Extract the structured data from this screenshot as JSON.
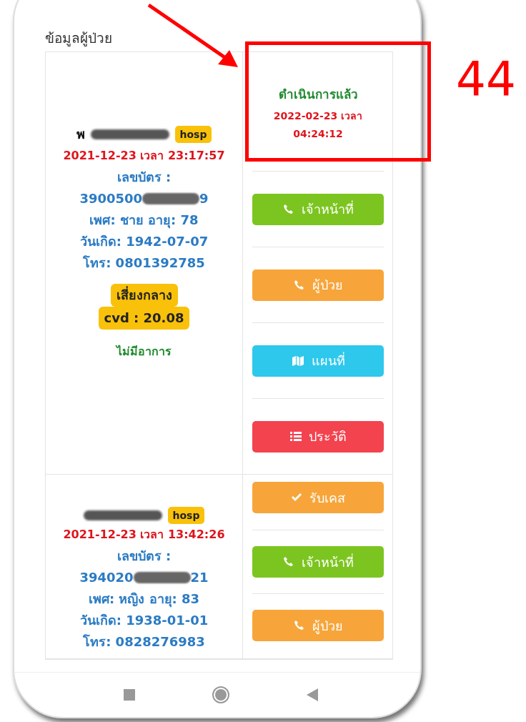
{
  "annotation": {
    "label": "44"
  },
  "page_title": "ข้อมูลผู้ป่วย",
  "patients": [
    {
      "name_visible": "พ",
      "badge": "hosp",
      "datetime": "2021-12-23 เวลา 23:17:57",
      "id_label": "เลขบัตร :",
      "id_prefix": "3900500",
      "id_suffix": "9",
      "sex_age": "เพศ: ชาย อายุ: 78",
      "birth": "วันเกิด: 1942-07-07",
      "phone": "โทร: 0801392785",
      "risk": "เสี่ยงกลาง",
      "cvd": "cvd : 20.08",
      "symptom": "ไม่มีอาการ",
      "status": {
        "title": "ดำเนินการแล้ว",
        "datetime": "2022-02-23 เวลา",
        "time": "04:24:12"
      },
      "actions": [
        {
          "kind": "phone",
          "label": "เจ้าหน้าที่",
          "color": "#7cc520"
        },
        {
          "kind": "phone",
          "label": "ผู้ป่วย",
          "color": "#f7a53a"
        },
        {
          "kind": "map",
          "label": "แผนที่",
          "color": "#2ec8ec"
        },
        {
          "kind": "list",
          "label": "ประวัติ",
          "color": "#f2434f"
        }
      ]
    },
    {
      "badge": "hosp",
      "datetime": "2021-12-23 เวลา 13:42:26",
      "id_label": "เลขบัตร :",
      "id_prefix": "394020",
      "id_suffix": "21",
      "sex_age": "เพศ: หญิง อายุ: 83",
      "birth": "วันเกิด: 1938-01-01",
      "phone": "โทร: 0828276983",
      "actions": [
        {
          "kind": "check",
          "label": "รับเคส",
          "color": "#f7a53a"
        },
        {
          "kind": "phone",
          "label": "เจ้าหน้าที่",
          "color": "#7cc520"
        },
        {
          "kind": "phone",
          "label": "ผู้ป่วย",
          "color": "#f7a53a"
        }
      ]
    }
  ]
}
